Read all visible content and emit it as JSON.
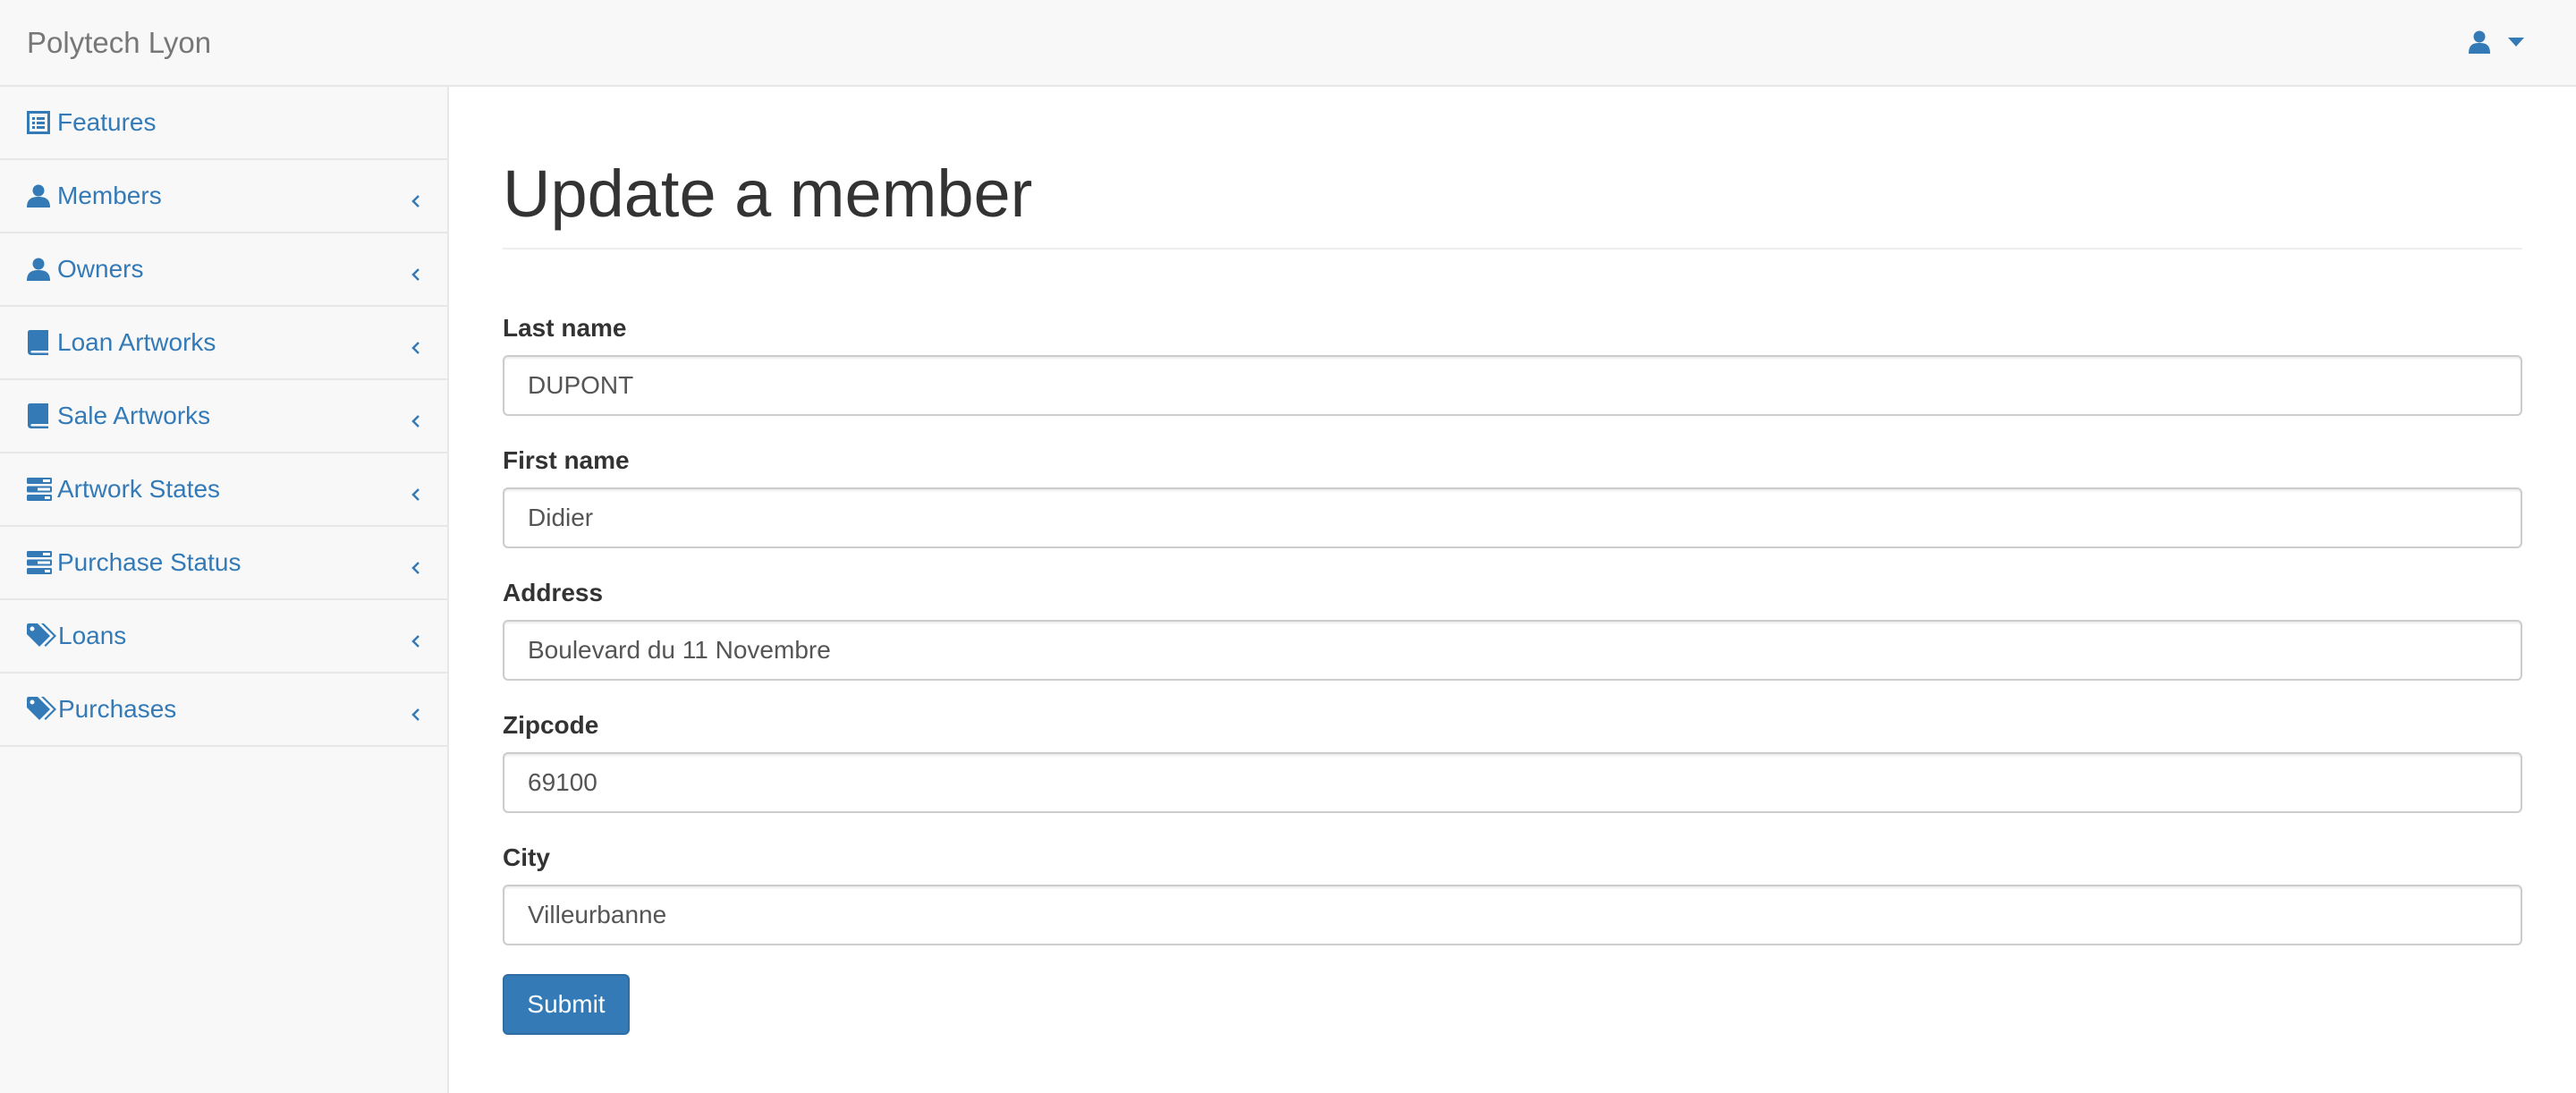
{
  "navbar": {
    "brand": "Polytech Lyon",
    "user_icon": "user-icon",
    "caret_icon": "caret-down-icon"
  },
  "sidebar": {
    "items": [
      {
        "label": "Features",
        "icon": "list-icon",
        "has_chevron": false
      },
      {
        "label": "Members",
        "icon": "user-icon",
        "has_chevron": true
      },
      {
        "label": "Owners",
        "icon": "user-icon",
        "has_chevron": true
      },
      {
        "label": "Loan Artworks",
        "icon": "book-icon",
        "has_chevron": true
      },
      {
        "label": "Sale Artworks",
        "icon": "book-icon",
        "has_chevron": true
      },
      {
        "label": "Artwork States",
        "icon": "tasks-icon",
        "has_chevron": true
      },
      {
        "label": "Purchase Status",
        "icon": "tasks-icon",
        "has_chevron": true
      },
      {
        "label": "Loans",
        "icon": "tags-icon",
        "has_chevron": true
      },
      {
        "label": "Purchases",
        "icon": "tags-icon",
        "has_chevron": true
      }
    ]
  },
  "main": {
    "title": "Update a member",
    "fields": [
      {
        "label": "Last name",
        "value": "DUPONT"
      },
      {
        "label": "First name",
        "value": "Didier"
      },
      {
        "label": "Address",
        "value": "Boulevard du 11 Novembre"
      },
      {
        "label": "Zipcode",
        "value": "69100"
      },
      {
        "label": "City",
        "value": "Villeurbanne"
      }
    ],
    "submit_label": "Submit"
  },
  "colors": {
    "link": "#337ab7",
    "brand_text": "#777777",
    "navbar_bg": "#f8f8f8",
    "border": "#e7e7e7",
    "button_bg": "#337ab7"
  }
}
